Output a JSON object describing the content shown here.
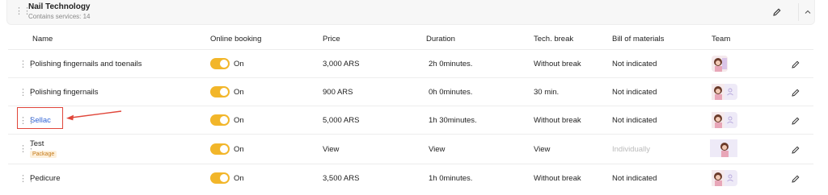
{
  "group": {
    "title": "Nail Technology",
    "subtitle": "Contains services: 14"
  },
  "columns": {
    "name": "Name",
    "online_booking": "Online booking",
    "price": "Price",
    "duration": "Duration",
    "tech_break": "Tech. break",
    "bill": "Bill of materials",
    "team": "Team"
  },
  "rows": [
    {
      "name": "Polishing fingernails and toenails",
      "online": "On",
      "price": "3,000 ARS",
      "duration": "2h 0minutes.",
      "break": "Without break",
      "bill": "Not indicated"
    },
    {
      "name": "Polishing fingernails",
      "online": "On",
      "price": "900 ARS",
      "duration": "0h 0minutes.",
      "break": "30 min.",
      "bill": "Not indicated"
    },
    {
      "name": "Sellac",
      "online": "On",
      "price": "5,000 ARS",
      "duration": "1h 30minutes.",
      "break": "Without break",
      "bill": "Not indicated"
    },
    {
      "name": "Test",
      "badge": "Package",
      "online": "On",
      "price": "View",
      "duration": "View",
      "break": "View",
      "bill": "Individually"
    },
    {
      "name": "Pedicure",
      "online": "On",
      "price": "3,500 ARS",
      "duration": "1h 0minutes.",
      "break": "Without break",
      "bill": "Not indicated"
    }
  ],
  "colors": {
    "toggle": "#f2b62a",
    "link": "#2f63d6",
    "annotation": "#e0463a",
    "badge_text": "#c47a18"
  },
  "icons": [
    "drag-handle-icon",
    "pencil-icon",
    "chevron-up-icon",
    "user-placeholder-icon"
  ]
}
